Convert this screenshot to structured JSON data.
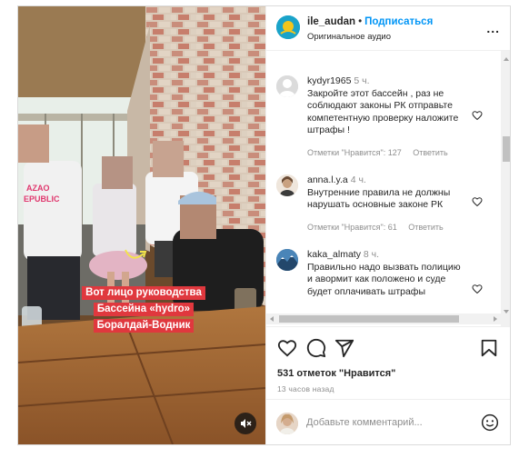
{
  "header": {
    "username": "ile_audan",
    "dot": "•",
    "follow_label": "Подписаться",
    "audio_label": "Оригинальное аудио",
    "more_label": "..."
  },
  "video": {
    "caption_lines": [
      "Вот лицо руководства",
      "Бассейна «hydro»",
      "Боралдай-Водник"
    ],
    "shirt_text_1": "AZAO",
    "shirt_text_2": "EPUBLIC"
  },
  "comments": [
    {
      "username": "kydyr1965",
      "time": "5 ч.",
      "text": "Закройте этот бассейн , раз не соблюдают законы РК отправьте компетентную проверку наложите штрафы !",
      "likes": "Отметки \"Нравится\": 127",
      "reply_label": "Ответить"
    },
    {
      "username": "anna.l.y.a",
      "time": "4 ч.",
      "text": "Внутренние правила не должны нарушать основные законе РК",
      "likes": "Отметки \"Нравится\": 61",
      "reply_label": "Ответить"
    },
    {
      "username": "kaka_almaty",
      "time": "8 ч.",
      "text": "Правильно надо вызвать полицию и авормит как положено и суде будет оплачивать штрафы",
      "likes": "",
      "reply_label": ""
    }
  ],
  "post": {
    "likes_count": "531 отметок \"Нравится\"",
    "time_ago": "13 часов назад"
  },
  "add_comment": {
    "placeholder": "Добавьте комментарий..."
  },
  "colors": {
    "accent": "#0095f6",
    "caption_bg": "#e0383e",
    "muted": "#8e8e8e"
  },
  "icons": [
    "heart-icon",
    "comment-icon",
    "share-icon",
    "bookmark-icon",
    "emoji-icon",
    "mute-icon",
    "more-icon"
  ]
}
